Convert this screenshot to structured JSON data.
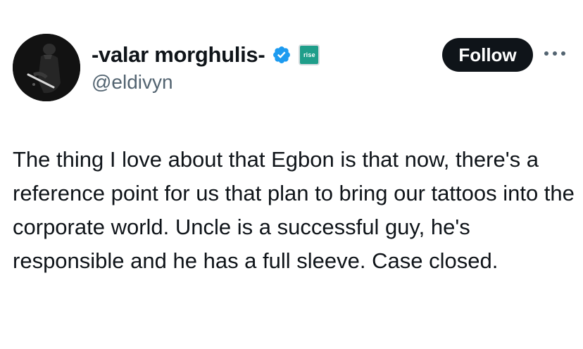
{
  "tweet": {
    "author": {
      "display_name": "-valar morghulis-",
      "handle": "@eldivyn",
      "verified": true,
      "verified_color": "#1d9bf0",
      "affiliate_badge_text": "rise",
      "affiliate_badge_color": "#1f9e8a",
      "avatar_icon": "profile-photo"
    },
    "follow_label": "Follow",
    "more_icon": "ellipsis-icon",
    "text": "The thing I love about that Egbon is that now, there's a reference point for us that plan to bring our tattoos into the corporate world. Uncle is a successful guy, he's responsible and he has a full sleeve. Case closed."
  }
}
